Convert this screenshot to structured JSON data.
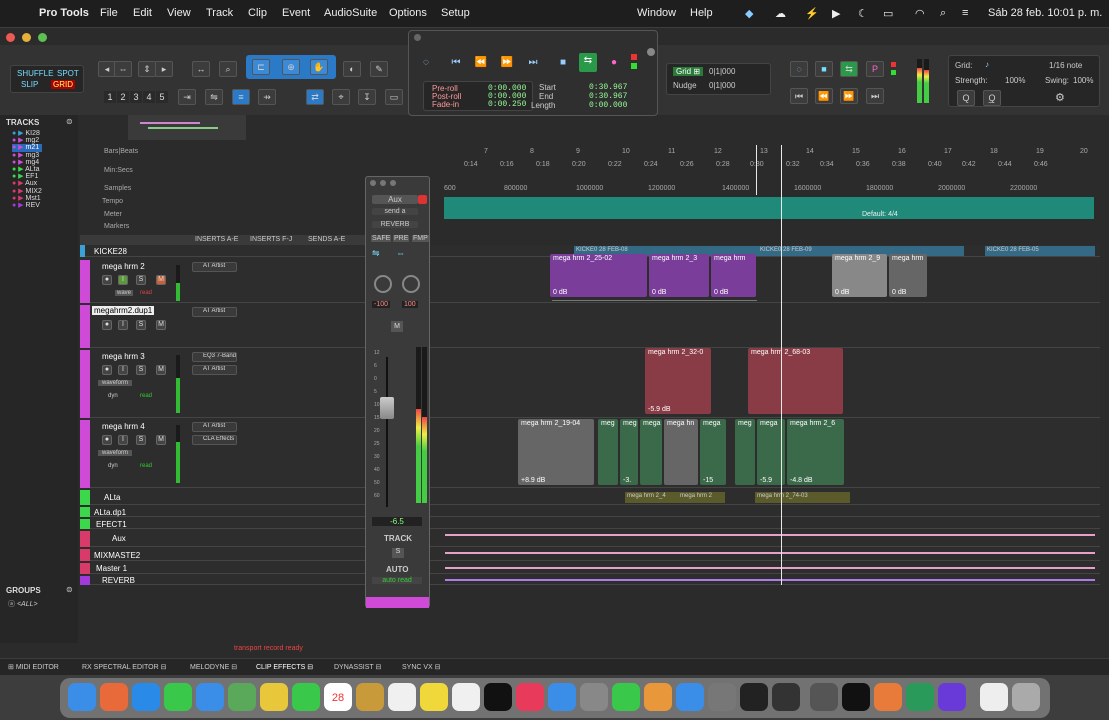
{
  "menubar": {
    "app": "Pro Tools",
    "items": [
      "File",
      "Edit",
      "View",
      "Track",
      "Clip",
      "Event",
      "AudioSuite",
      "Options",
      "Setup"
    ],
    "right_items": [
      "Window",
      "Help"
    ],
    "clock": "Sáb 28 feb.  10:01 p. m."
  },
  "toolbar": {
    "modes": [
      "SHUFFLE",
      "SPOT",
      "SLIP",
      "GRID"
    ],
    "zoom_presets": [
      "1",
      "2",
      "3",
      "4",
      "5"
    ],
    "grid_label": "Grid:",
    "grid_value": "1/16 note",
    "nudge_label": "Nudge",
    "nudge_value": "0|1|000",
    "nudge_value2": "0|1|000",
    "strength_label": "Strength:",
    "strength_value": "100%",
    "swing_label": "Swing:",
    "swing_value": "100%"
  },
  "transport": {
    "preroll_label": "Pre-roll",
    "postroll_label": "Post-roll",
    "fadein_label": "Fade-in",
    "preroll": "0:00.000",
    "postroll": "0:00.000",
    "fadein": "0:00.250",
    "start_label": "Start",
    "end_label": "End",
    "length_label": "Length",
    "start": "0:30.967",
    "end": "0:30.967",
    "length": "0:00.000"
  },
  "tracks_panel": {
    "title": "TRACKS",
    "items": [
      "KI28",
      "mg2",
      "m21",
      "mg3",
      "mg4",
      "ALta",
      "EF1",
      "Aux",
      "MIX2",
      "Mst1",
      "REV"
    ],
    "groups_title": "GROUPS",
    "groups_all": "<ALL>"
  },
  "rulers": {
    "bars_label": "Bars|Beats",
    "minsecs_label": "Min:Secs",
    "samples_label": "Samples",
    "tempo_label": "Tempo",
    "meter_label": "Meter",
    "markers_label": "Markers",
    "bars": [
      "7",
      "8",
      "9",
      "10",
      "11",
      "12",
      "13",
      "14",
      "15",
      "16",
      "17",
      "18",
      "19",
      "20"
    ],
    "times": [
      "0:14",
      "0:16",
      "0:18",
      "0:20",
      "0:22",
      "0:24",
      "0:26",
      "0:28",
      "0:30",
      "0:32",
      "0:34",
      "0:36",
      "0:38",
      "0:40",
      "0:42",
      "0:44",
      "0:46"
    ],
    "samples": [
      "600",
      "800000",
      "1000000",
      "1200000",
      "1400000",
      "1600000",
      "1800000",
      "2000000",
      "2200000"
    ],
    "meter_text": "Default: 4/4"
  },
  "headers": {
    "inserts_ae": "INSERTS A-E",
    "inserts_fj": "INSERTS F-J",
    "sends_ae": "SENDS A-E"
  },
  "tracks": [
    {
      "name": "KICKE28",
      "color": "#3aa0d8"
    },
    {
      "name": "mega hrm 2",
      "color": "#d04ad8",
      "insert": "AT Artist"
    },
    {
      "name": "megahrm2.dup1",
      "color": "#d04ad8",
      "insert": "AT Artist"
    },
    {
      "name": "mega hrm 3",
      "color": "#d04ad8",
      "insert": "EQ3 7-Band",
      "insert2": "AT Artist"
    },
    {
      "name": "mega hrm 4",
      "color": "#d04ad8",
      "insert": "AT Artist",
      "insert2": "CLA Effects"
    },
    {
      "name": "ALta",
      "color": "#3ad84a"
    },
    {
      "name": "ALta.dp1",
      "color": "#3ad84a"
    },
    {
      "name": "EFECT1",
      "color": "#3ad84a"
    },
    {
      "name": "Aux",
      "color": "#d83a6a"
    },
    {
      "name": "MIXMASTE2",
      "color": "#d83a6a"
    },
    {
      "name": "Master 1",
      "color": "#d83a6a"
    },
    {
      "name": "REVERB",
      "color": "#a03ad8"
    }
  ],
  "track_modes": {
    "waveform": "waveform",
    "wave": "wave",
    "dyn": "dyn",
    "read": "read"
  },
  "clips": {
    "kick": [
      "KICKE0 28 FEB-08",
      "KICKE0 28 FEB-09",
      "KICKE0 28 FEB-05"
    ],
    "row1": [
      {
        "name": "mega hrm 2_25-02",
        "gain": "0 dB"
      },
      {
        "name": "mega hrm 2_3",
        "gain": "0 dB"
      },
      {
        "name": "mega hrm",
        "gain": "0 dB"
      },
      {
        "name": "mega hrm 2_9",
        "gain": "0 dB"
      },
      {
        "name": "mega hrm",
        "gain": "0 dB"
      }
    ],
    "row2": [
      {
        "name": "mega hrm 2_32-0",
        "gain": "-5.9 dB"
      },
      {
        "name": "mega hrm 2_68-03",
        "gain": ""
      }
    ],
    "row3": [
      {
        "name": "mega hrm 2_19-04",
        "gain": "+8.9 dB"
      },
      {
        "name": "meg",
        "gain": ""
      },
      {
        "name": "meg",
        "gain": "-3."
      },
      {
        "name": "mega",
        "gain": ""
      },
      {
        "name": "mega hn",
        "gain": ""
      },
      {
        "name": "mega",
        "gain": "-15"
      },
      {
        "name": "meg",
        "gain": ""
      },
      {
        "name": "mega",
        "gain": "-5.9"
      },
      {
        "name": "mega hrm 2_6",
        "gain": "-4.8 dB"
      }
    ],
    "alta": [
      "mega hrm 2_4",
      "mega hrm 2",
      "mega hrm 2_74-03"
    ]
  },
  "mixer": {
    "type": "Aux",
    "send": "send a",
    "reverb": "REVERB",
    "safe": "SAFE",
    "pre": "PRE",
    "fmp": "FMP",
    "pan_l": "-100",
    "pan_r": "100",
    "fader_value": "-6.5",
    "track_label": "TRACK",
    "auto_label": "AUTO",
    "auto_mode": "auto read",
    "scale": [
      "12",
      "6",
      "0",
      "5",
      "10",
      "15",
      "20",
      "25",
      "30",
      "40",
      "50",
      "60"
    ]
  },
  "status": {
    "message": "transport record ready"
  },
  "bottom_tabs": [
    "MIDI EDITOR",
    "RX SPECTRAL EDITOR",
    "MELODYNE",
    "CLIP EFFECTS",
    "DYNASSIST",
    "SYNC VX"
  ],
  "dock_date": "28",
  "colors": {
    "accent": "#2a8fd8",
    "purple_clip": "#7a3d9a",
    "red_clip": "#8a3c46",
    "green_clip": "#3a6a4a",
    "grey_clip": "#666",
    "meter_bar": "#2a9a7a",
    "playhead": "#e8e8e8"
  }
}
